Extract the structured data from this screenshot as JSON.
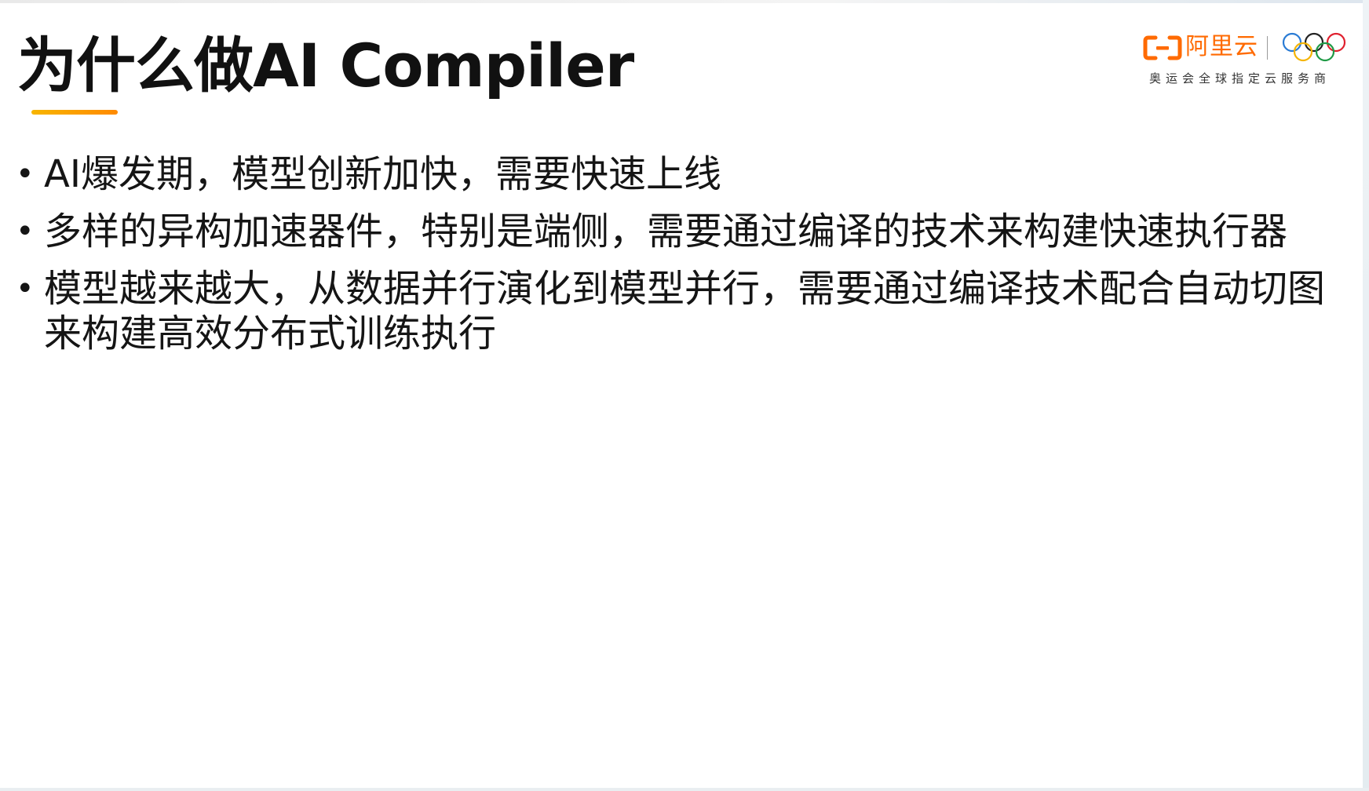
{
  "slide": {
    "title": "为什么做AI Compiler",
    "accent_color": "#ff8a00",
    "logo": {
      "brand": "阿里云",
      "tagline": "奥运会全球指定云服务商",
      "brand_color": "#ff6a00",
      "mark_icon": "aliyun-logo-icon",
      "partner_icon": "olympic-rings-icon"
    },
    "bullets": [
      {
        "text": "AI爆发期，模型创新加快，需要快速上线"
      },
      {
        "text": "多样的异构加速器件，特别是端侧，需要通过编译的技术来构建快速执行器"
      },
      {
        "text": "模型越来越大，从数据并行演化到模型并行，需要通过编译技术配合自动切图来构建高效分布式训练执行"
      }
    ],
    "bullet_glyph": "•"
  }
}
